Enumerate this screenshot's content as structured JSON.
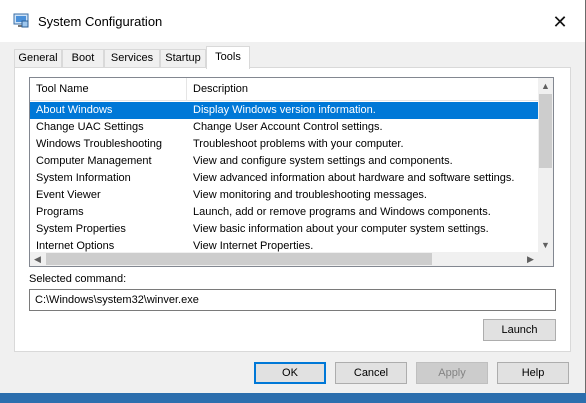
{
  "window": {
    "title": "System Configuration",
    "close_glyph": "✕"
  },
  "tabs": [
    {
      "label": "General",
      "active": false
    },
    {
      "label": "Boot",
      "active": false
    },
    {
      "label": "Services",
      "active": false
    },
    {
      "label": "Startup",
      "active": false
    },
    {
      "label": "Tools",
      "active": true
    }
  ],
  "tools_table": {
    "columns": [
      "Tool Name",
      "Description"
    ],
    "rows": [
      {
        "name": "About Windows",
        "description": "Display Windows version information.",
        "selected": true
      },
      {
        "name": "Change UAC Settings",
        "description": "Change User Account Control settings.",
        "selected": false
      },
      {
        "name": "Windows Troubleshooting",
        "description": "Troubleshoot problems with your computer.",
        "selected": false
      },
      {
        "name": "Computer Management",
        "description": "View and configure system settings and components.",
        "selected": false
      },
      {
        "name": "System Information",
        "description": "View advanced information about hardware and software settings.",
        "selected": false
      },
      {
        "name": "Event Viewer",
        "description": "View monitoring and troubleshooting messages.",
        "selected": false
      },
      {
        "name": "Programs",
        "description": "Launch, add or remove programs and Windows components.",
        "selected": false
      },
      {
        "name": "System Properties",
        "description": "View basic information about your computer system settings.",
        "selected": false
      },
      {
        "name": "Internet Options",
        "description": "View Internet Properties.",
        "selected": false
      }
    ]
  },
  "selected_command": {
    "label": "Selected command:",
    "value": "C:\\Windows\\system32\\winver.exe"
  },
  "buttons": {
    "launch": "Launch",
    "ok": "OK",
    "cancel": "Cancel",
    "apply": "Apply",
    "help": "Help"
  },
  "icons": {
    "app": "msconfig-icon",
    "close": "close-icon",
    "scroll_up": "▲",
    "scroll_down": "▼",
    "scroll_left": "◀",
    "scroll_right": "▶"
  },
  "colors": {
    "selection": "#0078d7",
    "default_button_border": "#0078d7",
    "desktop": "#1b4f86"
  }
}
